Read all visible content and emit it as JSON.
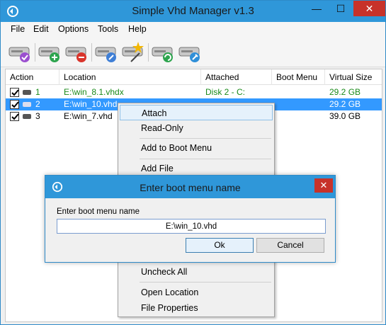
{
  "window": {
    "title": "Simple Vhd Manager v1.3",
    "controls": {
      "minimize": "—",
      "maximize": "☐",
      "close": "✕"
    }
  },
  "menu": [
    "File",
    "Edit",
    "Options",
    "Tools",
    "Help"
  ],
  "toolbar": {
    "buttons": [
      {
        "name": "check-disk-icon"
      },
      {
        "name": "add-disk-icon"
      },
      {
        "name": "remove-disk-icon"
      },
      {
        "name": "attach-disk-icon"
      },
      {
        "name": "edit-disk-icon"
      },
      {
        "name": "refresh-disk-icon"
      },
      {
        "name": "settings-disk-icon"
      }
    ]
  },
  "columns": [
    "Action",
    "Location",
    "Attached",
    "Boot Menu",
    "Virtual Size"
  ],
  "rows": [
    {
      "num": "1",
      "location": "E:\\win_8.1.vhdx",
      "attached": "Disk 2  -  C:",
      "boot": "",
      "size": "29.2 GB",
      "checked": true
    },
    {
      "num": "2",
      "location": "E:\\win_10.vhd",
      "attached": "",
      "boot": "",
      "size": "29.2 GB",
      "checked": true
    },
    {
      "num": "3",
      "location": "E:\\win_7.vhd",
      "attached": "",
      "boot": "",
      "size": "39.0 GB",
      "checked": true
    }
  ],
  "context_menu": {
    "items": [
      "Attach",
      "Read-Only",
      "Add to Boot Menu",
      "Add File",
      "Uncheck All",
      "Open Location",
      "File Properties"
    ]
  },
  "dialog": {
    "title": "Enter boot menu name",
    "label": "Enter boot menu name",
    "value": "E:\\win_10.vhd",
    "ok": "Ok",
    "cancel": "Cancel",
    "close": "✕"
  },
  "colors": {
    "accent": "#2f97d9",
    "selection": "#3399ff",
    "green_text": "#1a8a1a",
    "close_red": "#c7322a"
  }
}
